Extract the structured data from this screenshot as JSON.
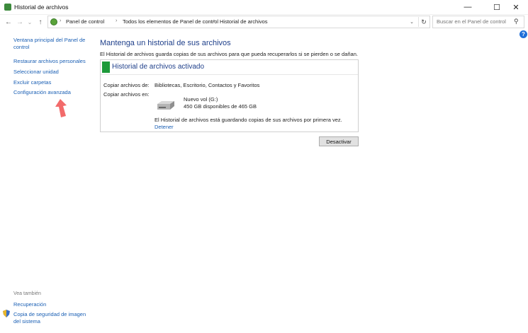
{
  "window": {
    "title": "Historial de archivos",
    "controls": {
      "minimize": "—",
      "maximize": "☐",
      "close": "✕"
    }
  },
  "navigation": {
    "back": "←",
    "forward": "→",
    "recent": "⌄",
    "up": "↑",
    "breadcrumbs": [
      "Panel de control",
      "Todos los elementos de Panel de control",
      "Historial de archivos"
    ],
    "separator": "›",
    "dropdown": "⌄",
    "refresh": "↻",
    "search_placeholder": "Buscar en el Panel de control",
    "search_icon": "⚲",
    "help": "?"
  },
  "sidebar": {
    "main_link": "Ventana principal del Panel de control",
    "items": [
      "Restaurar archivos personales",
      "Seleccionar unidad",
      "Excluir carpetas",
      "Configuración avanzada"
    ],
    "see_also_label": "Vea también",
    "see_also": [
      "Recuperación",
      "Copia de seguridad de imagen del sistema"
    ]
  },
  "main": {
    "title": "Mantenga un historial de sus archivos",
    "description": "El Historial de archivos guarda copias de sus archivos para que pueda recuperarlos si se pierden o se dañan.",
    "status_title": "Historial de archivos activado",
    "copy_from_label": "Copiar archivos de:",
    "copy_from_value": "Bibliotecas, Escritorio, Contactos y Favoritos",
    "copy_to_label": "Copiar archivos en:",
    "drive_name": "Nuevo vol (G:)",
    "drive_space": "450 GB disponibles de 465 GB",
    "progress_message": "El Historial de archivos está guardando copias de sus archivos por primera vez.",
    "stop_link": "Detener",
    "deactivate_button": "Desactivar"
  },
  "colors": {
    "accent_green": "#1e9a3a",
    "link_blue": "#1a5fb4",
    "heading_blue": "#1e3f8a",
    "annotation_arrow": "#f26b6b"
  }
}
